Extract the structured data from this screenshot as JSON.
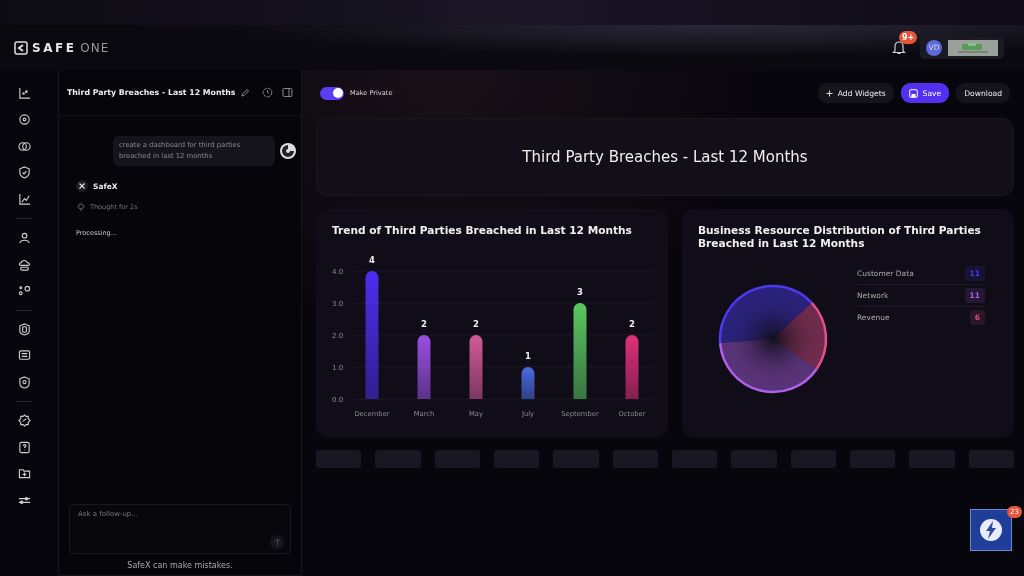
{
  "brand": {
    "word1": "SAFE",
    "word2": "ONE"
  },
  "header": {
    "notification_badge": "9+",
    "avatar": "VD"
  },
  "chat": {
    "title": "Third Party Breaches - Last 12 Months",
    "user_message": "create a dashboard for third parties breached in last 12 months",
    "assistant": "SafeX",
    "thought": "Thought for 2s",
    "status": "Processing...",
    "input": {
      "placeholder": "Ask a follow-up..."
    },
    "disclaimer": "SafeX can make mistakes."
  },
  "toolbar": {
    "make_private": {
      "label": "Make Private",
      "on": true
    },
    "buttons": [
      {
        "label": "Add Widgets",
        "kind": "add"
      },
      {
        "label": "Save",
        "kind": "save"
      },
      {
        "label": "Download",
        "kind": "plain"
      }
    ]
  },
  "dashboard_title": "Third Party Breaches - Last 12 Months",
  "widgets": [
    {
      "title": "Trend of Third Parties Breached in Last 12 Months",
      "chart_data": {
        "type": "bar",
        "categories": [
          "December",
          "March",
          "May",
          "July",
          "September",
          "October"
        ],
        "series": [
          {
            "values": [
              4,
              2,
              2,
              1,
              3,
              2
            ]
          }
        ],
        "colors": [
          "#4a2ff0",
          "#9a4fe0",
          "#d45a9a",
          "#4a6ae0",
          "#5ac860",
          "#e0307a"
        ],
        "ylim": [
          0,
          4
        ],
        "grid": true,
        "yticks": [
          {
            "value": 0,
            "label": "0.0"
          },
          {
            "value": 1,
            "label": "1.0"
          },
          {
            "value": 2,
            "label": "2.0"
          },
          {
            "value": 3,
            "label": "3.0"
          },
          {
            "value": 4,
            "label": "4.0"
          }
        ],
        "data_labels": true
      }
    },
    {
      "title": "Business Resource Distribution of Third Parties Breached in Last 12 Months",
      "chart_data": {
        "type": "pie",
        "categories": [
          "Customer Data",
          "Network",
          "Revenue"
        ],
        "series": [
          {
            "values": [
              39.29,
              39.29,
              21.42
            ]
          }
        ],
        "colors": [
          "#4b3af0",
          "#b060e8",
          "#e0508a"
        ],
        "value_labels": [
          "11",
          "11",
          "6"
        ]
      }
    }
  ],
  "floating_widget": {
    "badge": "23"
  }
}
